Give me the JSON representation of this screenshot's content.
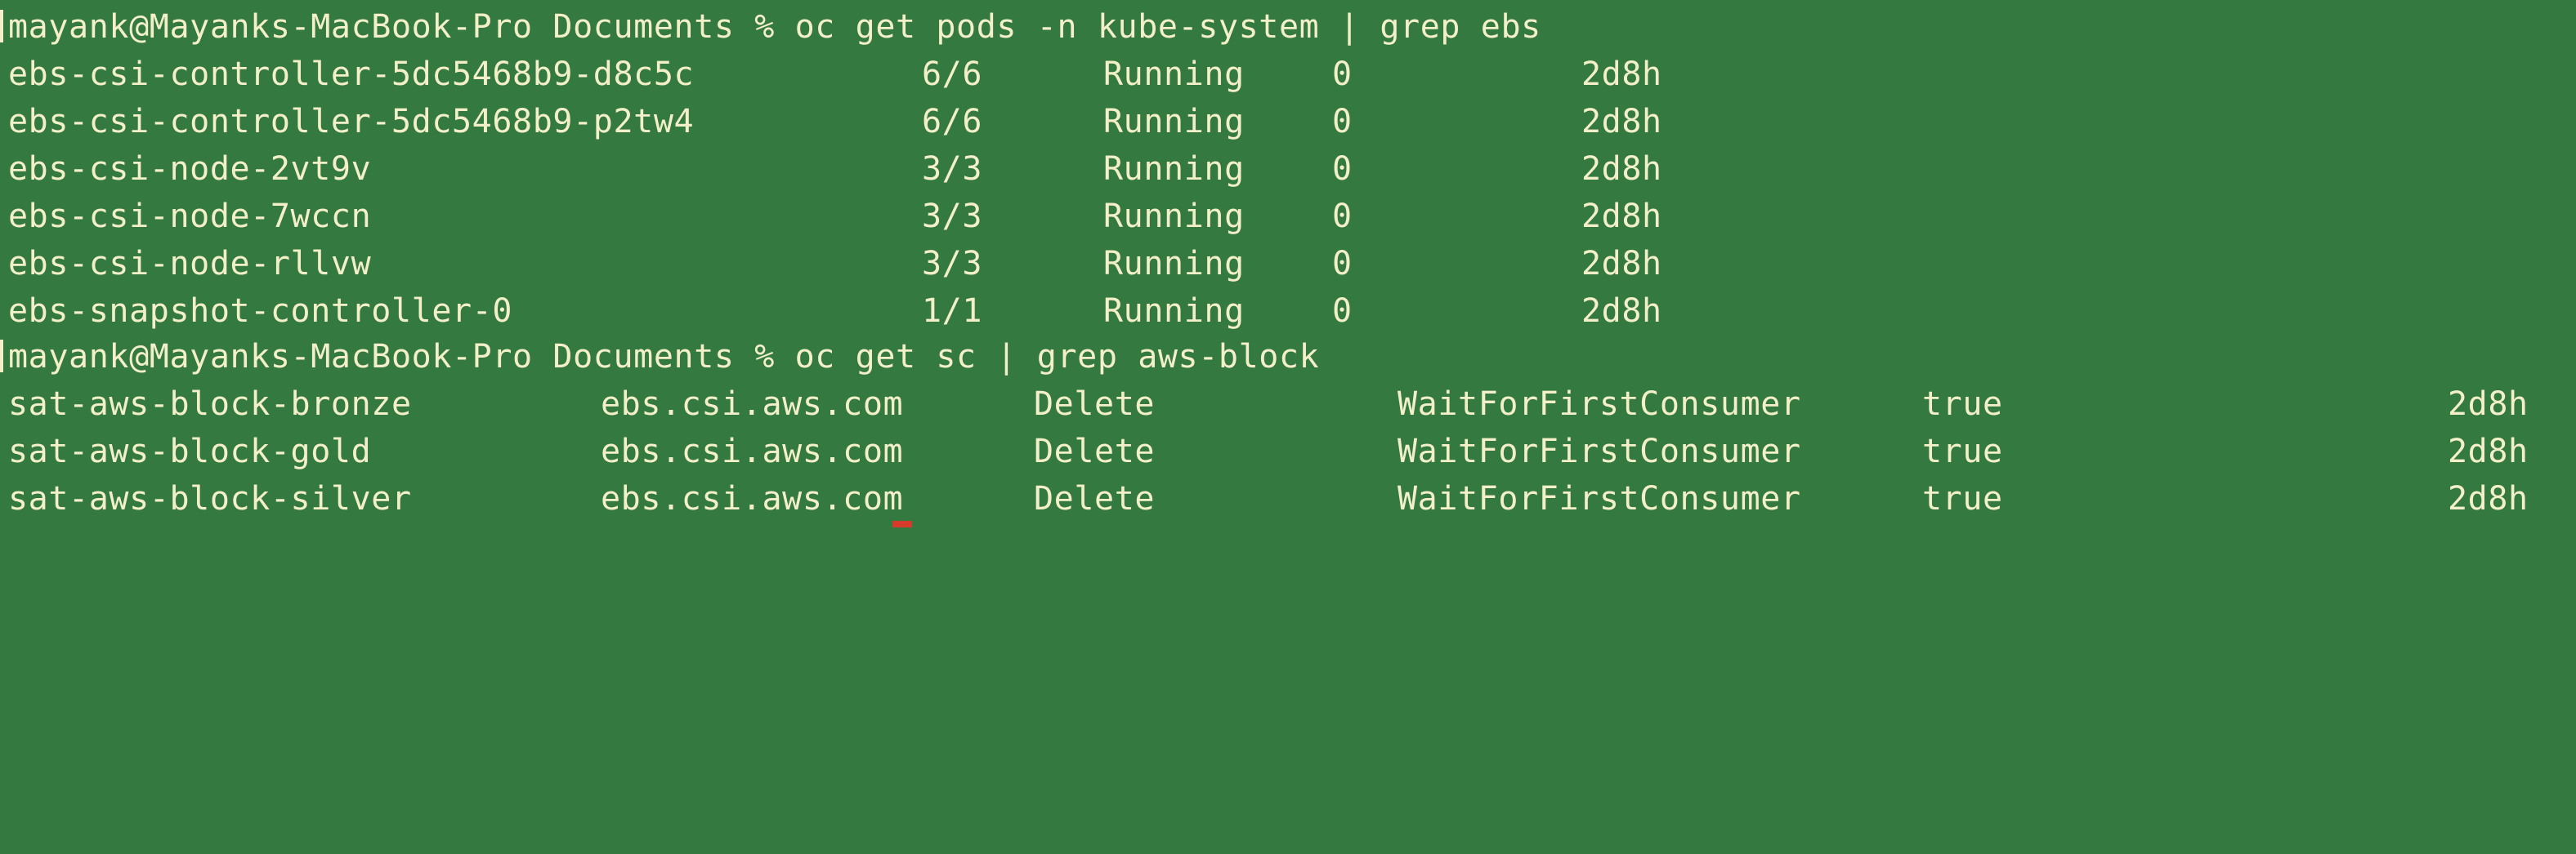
{
  "colors": {
    "background": "#347940",
    "foreground": "#f3f0c9",
    "marker": "#d53a2b"
  },
  "commands": [
    "mayank@Mayanks-MacBook-Pro Documents % oc get pods -n kube-system | grep ebs",
    "mayank@Mayanks-MacBook-Pro Documents % oc get sc | grep aws-block"
  ],
  "pods": [
    {
      "name": "ebs-csi-controller-5dc5468b9-d8c5c",
      "ready": "6/6",
      "status": "Running",
      "restarts": "0",
      "age": "2d8h"
    },
    {
      "name": "ebs-csi-controller-5dc5468b9-p2tw4",
      "ready": "6/6",
      "status": "Running",
      "restarts": "0",
      "age": "2d8h"
    },
    {
      "name": "ebs-csi-node-2vt9v",
      "ready": "3/3",
      "status": "Running",
      "restarts": "0",
      "age": "2d8h"
    },
    {
      "name": "ebs-csi-node-7wccn",
      "ready": "3/3",
      "status": "Running",
      "restarts": "0",
      "age": "2d8h"
    },
    {
      "name": "ebs-csi-node-rllvw",
      "ready": "3/3",
      "status": "Running",
      "restarts": "0",
      "age": "2d8h"
    },
    {
      "name": "ebs-snapshot-controller-0",
      "ready": "1/1",
      "status": "Running",
      "restarts": "0",
      "age": "2d8h"
    }
  ],
  "storage_classes": [
    {
      "name": "sat-aws-block-bronze",
      "provisioner": "ebs.csi.aws.com",
      "reclaim": "Delete",
      "binding": "WaitForFirstConsumer",
      "expansion": "true",
      "age": "2d8h"
    },
    {
      "name": "sat-aws-block-gold",
      "provisioner": "ebs.csi.aws.com",
      "reclaim": "Delete",
      "binding": "WaitForFirstConsumer",
      "expansion": "true",
      "age": "2d8h"
    },
    {
      "name": "sat-aws-block-silver",
      "provisioner": "ebs.csi.aws.com",
      "reclaim": "Delete",
      "binding": "WaitForFirstConsumer",
      "expansion": "true",
      "age": "2d8h"
    }
  ]
}
